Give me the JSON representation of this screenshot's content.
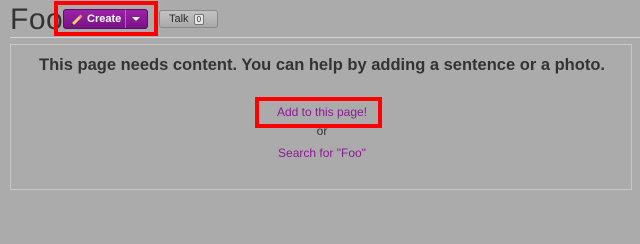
{
  "page": {
    "title": "Foo"
  },
  "toolbar": {
    "create_label": "Create",
    "talk_label": "Talk",
    "talk_count": "0"
  },
  "content": {
    "headline": "This page needs content. You can help by adding a sentence or a photo.",
    "add_link": "Add to this page!",
    "or_text": "or",
    "search_link": "Search for \"Foo\""
  },
  "colors": {
    "background": "#ababab",
    "create_button": "#8a1a96",
    "link": "#8b1a95",
    "highlight": "#ff0000"
  },
  "icons": {
    "create": "pencil-icon",
    "dropdown": "chevron-down-icon"
  }
}
